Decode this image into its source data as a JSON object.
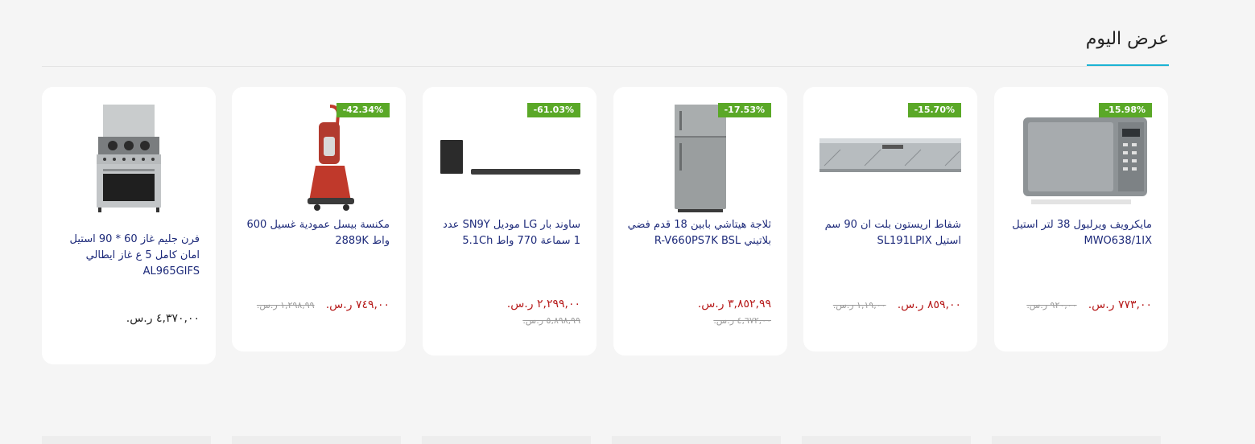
{
  "section": {
    "title": "عرض اليوم"
  },
  "products": [
    {
      "name": "مايكرويف ويرلبول 38 لتر استيل MWO638/1IX",
      "badge": "-15.98%",
      "price": "٧٧٣,٠٠ ر.س.",
      "old_price": "٩٢٠,٠٠ ر.س.",
      "icon": "microwave-image"
    },
    {
      "name": "شفاط اريستون بلت ان 90 سم استيل SL191LPIX",
      "badge": "-15.70%",
      "price": "٨٥٩,٠٠ ر.س.",
      "old_price": "١,١٩,٠٠ ر.س.",
      "icon": "hood-image"
    },
    {
      "name": "ثلاجة هيتاشي بابين 18 قدم فضي بلاتيني R-V660PS7K BSL",
      "badge": "-17.53%",
      "price": "٣,٨٥٢,٩٩ ر.س.",
      "old_price": "٤,٦٧٢,٠٠ ر.س.",
      "icon": "fridge-image"
    },
    {
      "name": "ساوند بار LG موديل SN9Y عدد 1 سماعة 770 واط 5.1Ch",
      "badge": "-61.03%",
      "price": "٢,٢٩٩,٠٠ ر.س.",
      "old_price": "٥,٨٩٨,٩٩ ر.س.",
      "icon": "soundbar-image"
    },
    {
      "name": "مكنسة بيسل عمودية غسيل 600 واط 2889K",
      "badge": "-42.34%",
      "price": "٧٤٩,٠٠ ر.س.",
      "old_price": "١,٢٩٨,٩٩ ر.س.",
      "icon": "vacuum-image"
    },
    {
      "name": "فرن جليم غاز 60 * 90 استيل امان كامل 5 ع غاز ايطالي AL965GIFS",
      "badge": "",
      "price": "٤,٣٧٠,٠٠ ر.س.",
      "old_price": "",
      "icon": "oven-image"
    }
  ],
  "colors": {
    "accent": "#1bb3d4",
    "badge": "#5aa827",
    "sale_price": "#b71c1c",
    "name": "#1d2a7a"
  }
}
